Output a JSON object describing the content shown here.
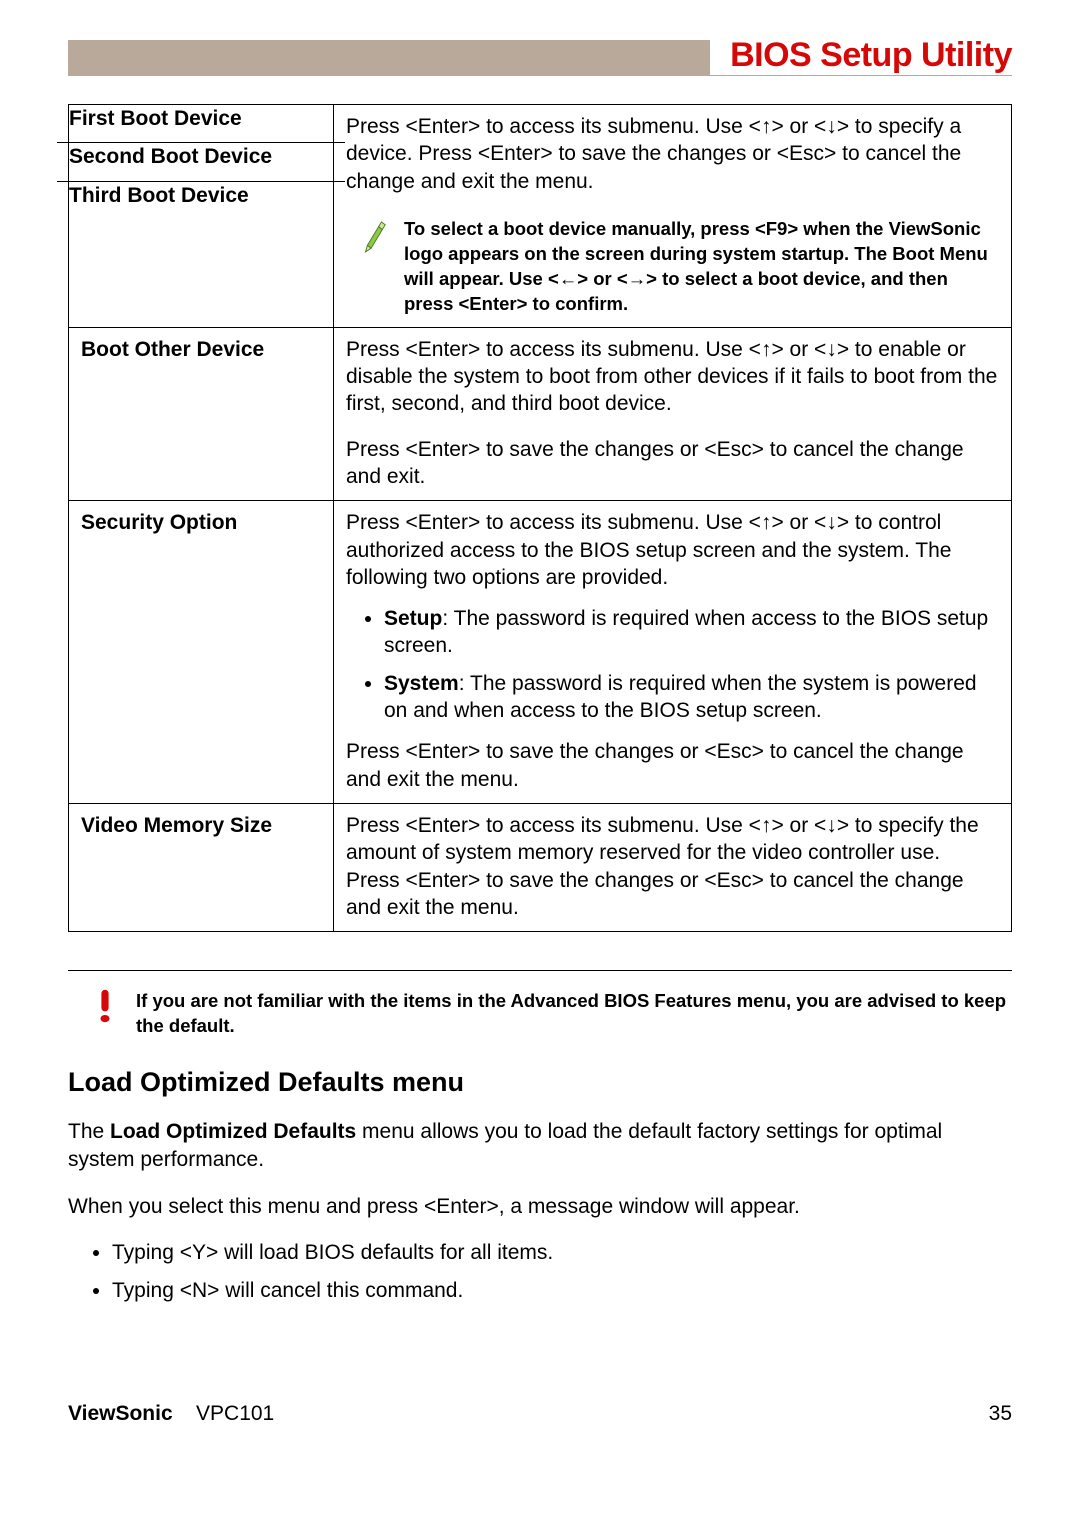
{
  "header": {
    "title": "BIOS Setup Utility"
  },
  "table": {
    "row1": {
      "l1": "First Boot Device",
      "l2": "Second Boot Device",
      "l3": "Third Boot Device",
      "desc_para": "Press <Enter> to access its submenu. Use <↑> or <↓> to specify a device. Press <Enter> to save the changes or <Esc> to cancel the change and exit the menu.",
      "note": "To select a boot device manually, press <F9> when the ViewSonic logo appears on the screen during system startup. The Boot Menu will appear. Use <←> or <→> to select a boot device, and then press <Enter> to confirm."
    },
    "row2": {
      "l": "Boot Other Device",
      "p1": "Press <Enter> to access its submenu. Use <↑> or <↓> to enable or disable the system to boot from other devices if it fails to boot from the first, second, and third boot device.",
      "p2": "Press <Enter> to save the changes or <Esc> to cancel the change and exit."
    },
    "row3": {
      "l": "Security Option",
      "p1": "Press <Enter> to access its submenu. Use <↑> or <↓> to control authorized access to the BIOS setup screen and the system. The following two options are provided.",
      "li1_b": "Setup",
      "li1_t": ": The password is required when access to the BIOS setup screen.",
      "li2_b": "System",
      "li2_t": ": The password is required when the system is powered on and when access to the BIOS setup screen.",
      "p2": "Press <Enter> to save the changes or <Esc> to cancel the change and exit the menu."
    },
    "row4": {
      "l": "Video Memory Size",
      "p1": "Press <Enter> to access its submenu. Use <↑> or <↓> to specify the amount of system memory reserved for the video controller use. Press <Enter> to save the changes or <Esc> to cancel the change and exit the menu."
    }
  },
  "warning": "If you are not familiar with the items in the Advanced BIOS Features menu, you are advised to keep the default.",
  "section": {
    "heading": "Load Optimized Defaults menu",
    "p1_a": "The ",
    "p1_b": "Load Optimized Defaults",
    "p1_c": " menu allows you to load the default factory settings for optimal system performance.",
    "p2": "When you select this menu and press <Enter>, a message window will appear.",
    "li1": "Typing <Y> will load BIOS defaults for all items.",
    "li2": "Typing <N> will cancel this command."
  },
  "footer": {
    "brand": "ViewSonic",
    "model": "VPC101",
    "page": "35"
  }
}
